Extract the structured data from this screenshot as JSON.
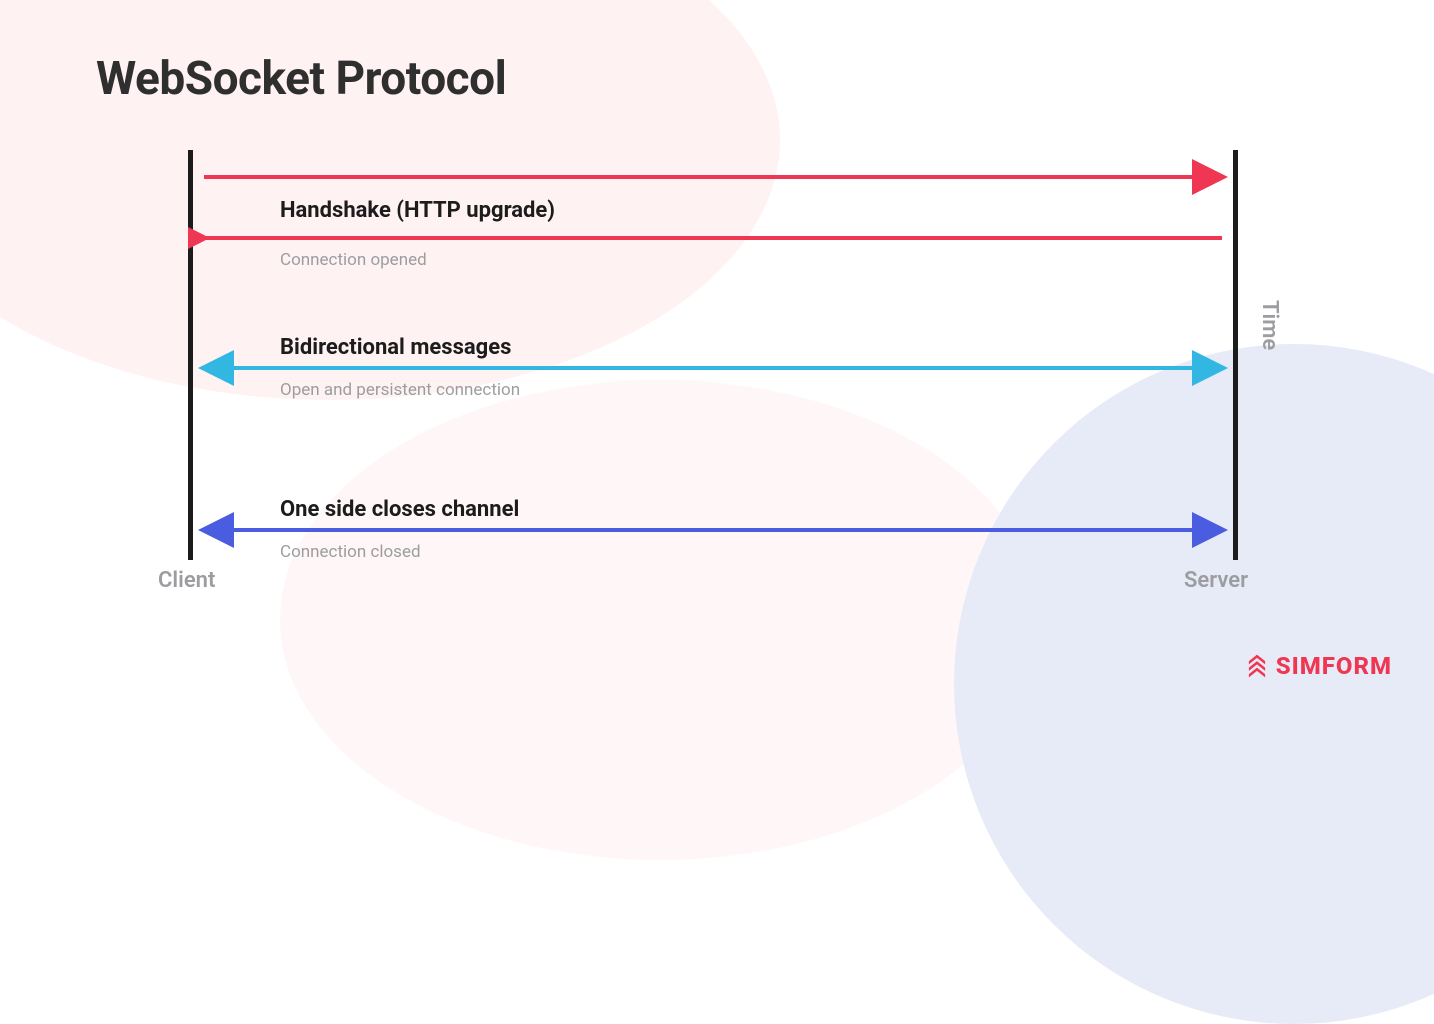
{
  "title": "WebSocket Protocol",
  "endpoints": {
    "client": "Client",
    "server": "Server"
  },
  "time_label": "Time",
  "messages": {
    "handshake": {
      "label": "Handshake (HTTP upgrade)",
      "sub": "Connection opened",
      "color": "#ef3753"
    },
    "bidirectional": {
      "label": "Bidirectional messages",
      "sub": "Open and persistent connection",
      "color": "#31b7e2"
    },
    "close": {
      "label": "One side closes channel",
      "sub": "Connection  closed",
      "color": "#4a5ce0"
    }
  },
  "brand": "SIMFORM"
}
